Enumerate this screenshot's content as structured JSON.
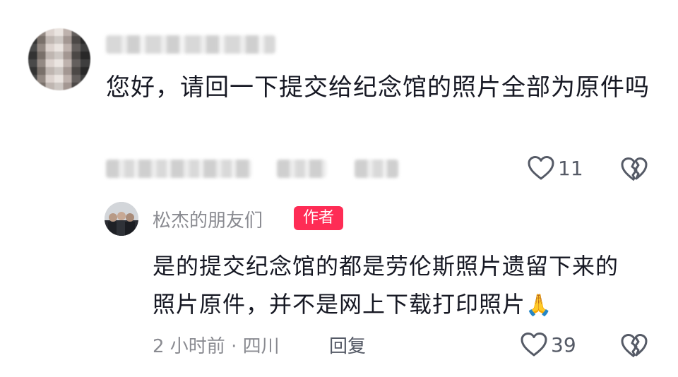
{
  "comment": {
    "text": "您好，请回一下提交给纪念馆的照片全部为原件吗",
    "like_count": "11"
  },
  "reply": {
    "author": "松杰的朋友们",
    "badge": "作者",
    "text": "是的提交纪念馆的都是劳伦斯照片遗留下来的照片原件，并不是网上下载打印照片",
    "emoji": "🙏",
    "meta": "2 小时前 · 四川",
    "reply_label": "回复",
    "like_count": "39"
  },
  "icons": {
    "like": "heart-outline-icon",
    "dislike": "broken-heart-icon",
    "emoji": "praying-hands-emoji"
  },
  "colors": {
    "badge": "#fe2c55",
    "meta_text": "#8a8b91",
    "main_text": "#161823"
  }
}
